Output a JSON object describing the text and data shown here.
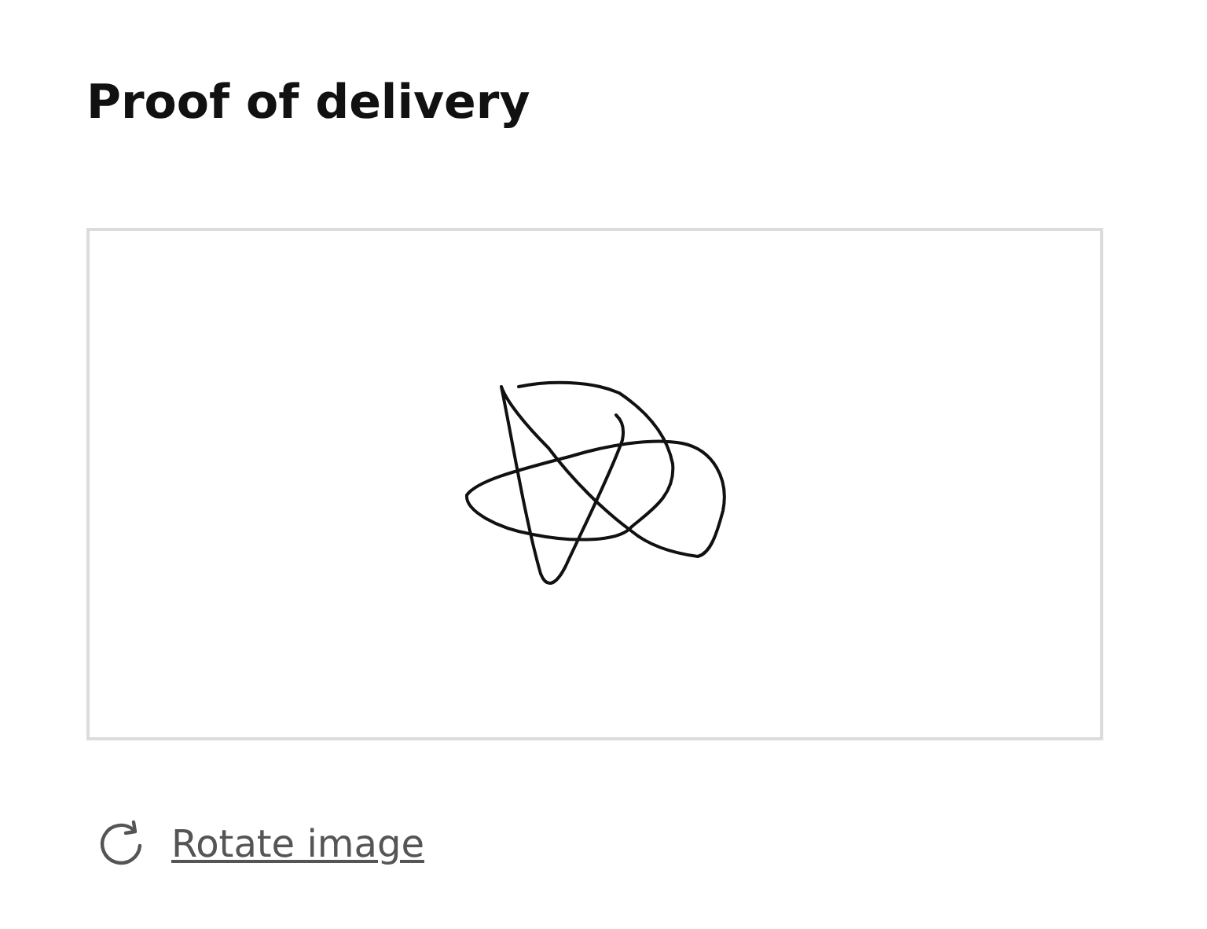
{
  "title": "Proof of delivery",
  "rotate_link": {
    "label": "Rotate image"
  }
}
